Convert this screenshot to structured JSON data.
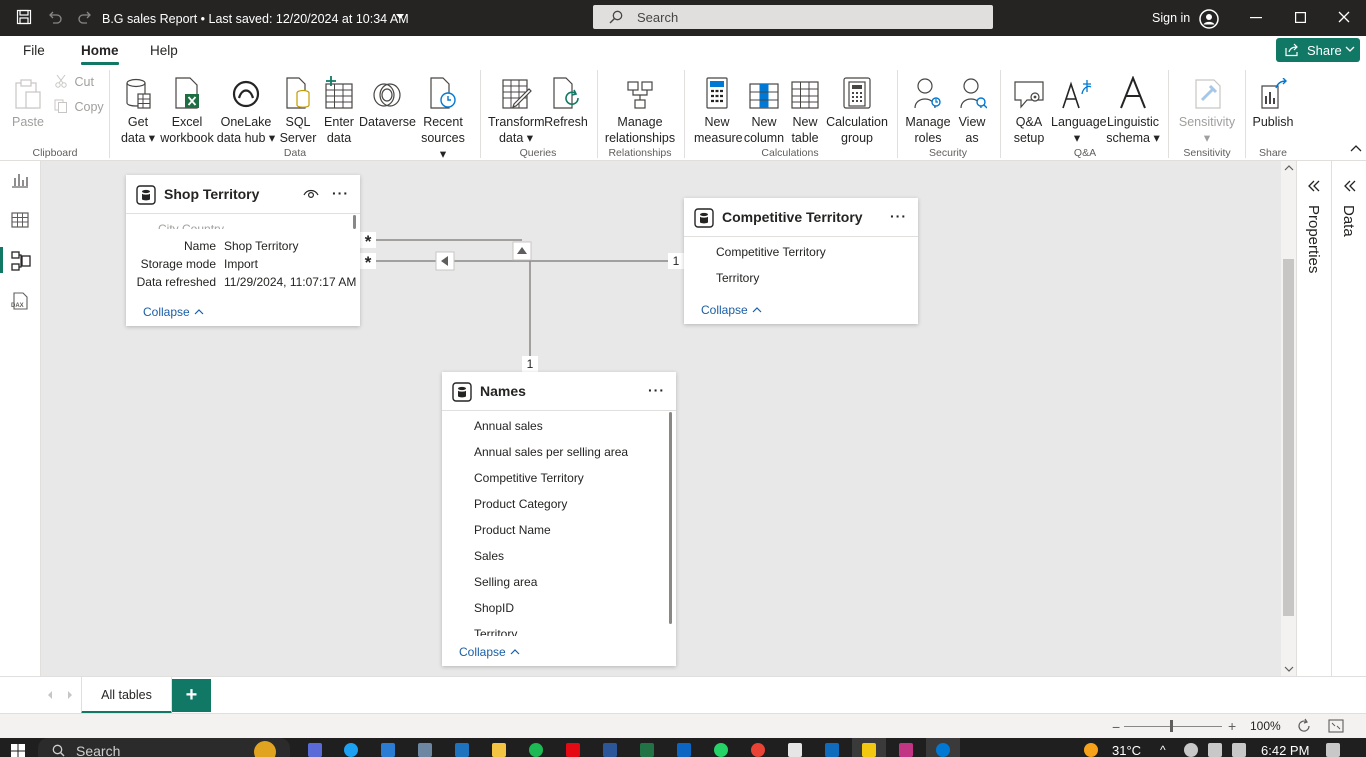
{
  "titlebar": {
    "document_title": "B.G sales Report • Last saved: 12/20/2024 at 10:34 AM",
    "search_placeholder": "Search",
    "sign_in": "Sign in"
  },
  "menu": {
    "tabs": [
      "File",
      "Home",
      "Help"
    ],
    "active_tab": "Home",
    "share_label": "Share"
  },
  "ribbon": {
    "clipboard": {
      "paste": "Paste",
      "cut": "Cut",
      "copy": "Copy",
      "group": "Clipboard"
    },
    "data": {
      "get_data": [
        "Get",
        "data"
      ],
      "excel": [
        "Excel",
        "workbook"
      ],
      "onelake": [
        "OneLake",
        "data hub"
      ],
      "sql": [
        "SQL",
        "Server"
      ],
      "enter": [
        "Enter",
        "data"
      ],
      "dataverse": [
        "Dataverse"
      ],
      "recent": [
        "Recent",
        "sources"
      ],
      "group": "Data"
    },
    "queries": {
      "transform": [
        "Transform",
        "data"
      ],
      "refresh": [
        "Refresh"
      ],
      "group": "Queries"
    },
    "relationships": {
      "manage": [
        "Manage",
        "relationships"
      ],
      "group": "Relationships"
    },
    "calculations": {
      "new_measure": [
        "New",
        "measure"
      ],
      "new_column": [
        "New",
        "column"
      ],
      "new_table": [
        "New",
        "table"
      ],
      "calc_group": [
        "Calculation",
        "group"
      ],
      "group": "Calculations"
    },
    "security": {
      "manage_roles": [
        "Manage",
        "roles"
      ],
      "view_as": [
        "View",
        "as"
      ],
      "group": "Security"
    },
    "qa": {
      "qa_setup": [
        "Q&A",
        "setup"
      ],
      "language": [
        "Language"
      ],
      "linguistic": [
        "Linguistic",
        "schema"
      ],
      "group": "Q&A"
    },
    "sensitivity": {
      "label": [
        "Sensitivity"
      ],
      "group": "Sensitivity"
    },
    "share": {
      "publish": [
        "Publish"
      ],
      "group": "Share"
    }
  },
  "panes": {
    "properties": "Properties",
    "data": "Data"
  },
  "model": {
    "shop_territory": {
      "title": "Shop Territory",
      "partial_field": "City Country",
      "collapse": "Collapse",
      "tooltip": {
        "name_label": "Name",
        "name_value": "Shop Territory",
        "storage_label": "Storage mode",
        "storage_value": "Import",
        "refreshed_label": "Data refreshed",
        "refreshed_value": "11/29/2024, 11:07:17 AM"
      }
    },
    "competitive_territory": {
      "title": "Competitive Territory",
      "fields": [
        "Competitive Territory",
        "Territory"
      ],
      "collapse": "Collapse"
    },
    "names": {
      "title": "Names",
      "fields": [
        "Annual sales",
        "Annual sales per selling area",
        "Competitive Territory",
        "Product Category",
        "Product Name",
        "Sales",
        "Selling area",
        "ShopID",
        "Territory"
      ],
      "collapse": "Collapse"
    },
    "relationships": {
      "many_symbol": "*",
      "one_symbol": "1"
    }
  },
  "tabs": {
    "all_tables": "All tables",
    "add": "+"
  },
  "status": {
    "zoom": "100%"
  },
  "taskbar": {
    "search": "Search",
    "temperature": "31°C",
    "time": "6:42 PM"
  },
  "colors": {
    "accent": "#117865",
    "titlebar": "#252423",
    "link": "#1a5fa6"
  }
}
